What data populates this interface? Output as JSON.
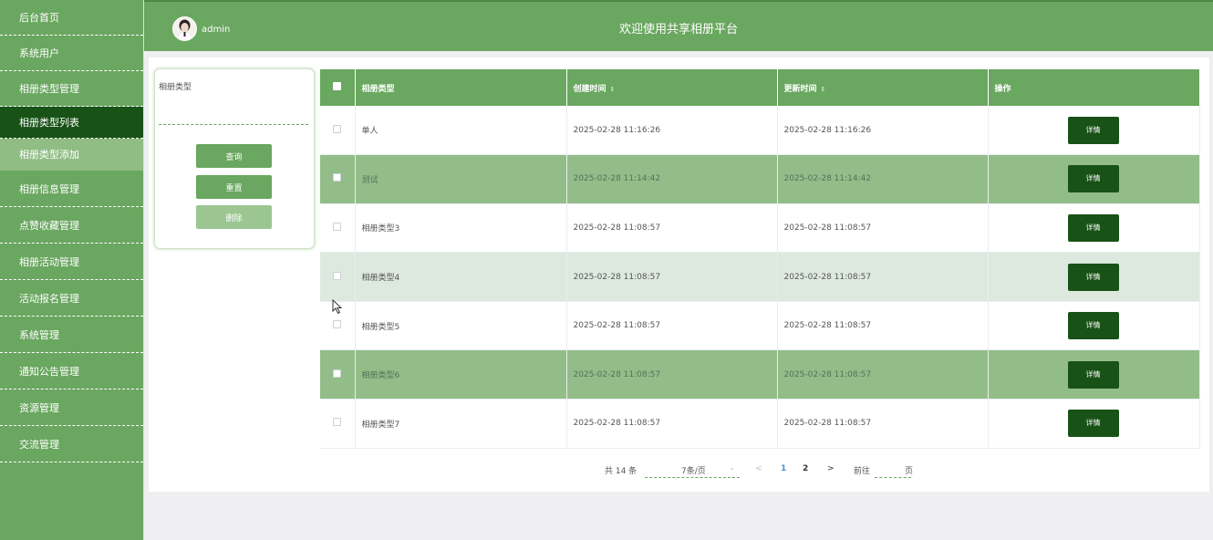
{
  "sidebar": {
    "items": [
      {
        "label": "后台首页",
        "state": "normal"
      },
      {
        "label": "系统用户",
        "state": "normal"
      },
      {
        "label": "相册类型管理",
        "state": "normal"
      },
      {
        "label": "相册类型列表",
        "state": "active"
      },
      {
        "label": "相册类型添加",
        "state": "sub"
      },
      {
        "label": "相册信息管理",
        "state": "normal"
      },
      {
        "label": "点赞收藏管理",
        "state": "normal"
      },
      {
        "label": "相册活动管理",
        "state": "normal"
      },
      {
        "label": "活动报名管理",
        "state": "normal"
      },
      {
        "label": "系统管理",
        "state": "normal"
      },
      {
        "label": "通知公告管理",
        "state": "normal"
      },
      {
        "label": "资源管理",
        "state": "normal"
      },
      {
        "label": "交流管理",
        "state": "normal"
      }
    ]
  },
  "header": {
    "username": "admin",
    "title": "欢迎使用共享相册平台"
  },
  "search": {
    "label": "相册类型",
    "value": "",
    "query_label": "查询",
    "reset_label": "重置",
    "delete_label": "删除"
  },
  "table": {
    "headers": {
      "type": "相册类型",
      "created": "创建时间",
      "updated": "更新时间",
      "ops": "操作"
    },
    "sort_icon": "⇕",
    "rows": [
      {
        "type": "单人",
        "created": "2025-02-28 11:16:26",
        "updated": "2025-02-28 11:16:26",
        "action": "详情"
      },
      {
        "type": "测试",
        "created": "2025-02-28 11:14:42",
        "updated": "2025-02-28 11:14:42",
        "action": "详情"
      },
      {
        "type": "相册类型3",
        "created": "2025-02-28 11:08:57",
        "updated": "2025-02-28 11:08:57",
        "action": "详情"
      },
      {
        "type": "相册类型4",
        "created": "2025-02-28 11:08:57",
        "updated": "2025-02-28 11:08:57",
        "action": "详情"
      },
      {
        "type": "相册类型5",
        "created": "2025-02-28 11:08:57",
        "updated": "2025-02-28 11:08:57",
        "action": "详情"
      },
      {
        "type": "相册类型6",
        "created": "2025-02-28 11:08:57",
        "updated": "2025-02-28 11:08:57",
        "action": "详情"
      },
      {
        "type": "相册类型7",
        "created": "2025-02-28 11:08:57",
        "updated": "2025-02-28 11:08:57",
        "action": "详情"
      }
    ]
  },
  "pagination": {
    "total": "共 14 条",
    "page_size": "7条/页",
    "prev": "<",
    "pages": [
      "1",
      "2"
    ],
    "current": "1",
    "next": ">",
    "goto_prefix": "前往",
    "goto_suffix": "页"
  },
  "colors": {
    "primary": "#6aa760",
    "dark": "#185216",
    "row_highlight": "#92bd89",
    "row_hover": "#dde9df"
  }
}
